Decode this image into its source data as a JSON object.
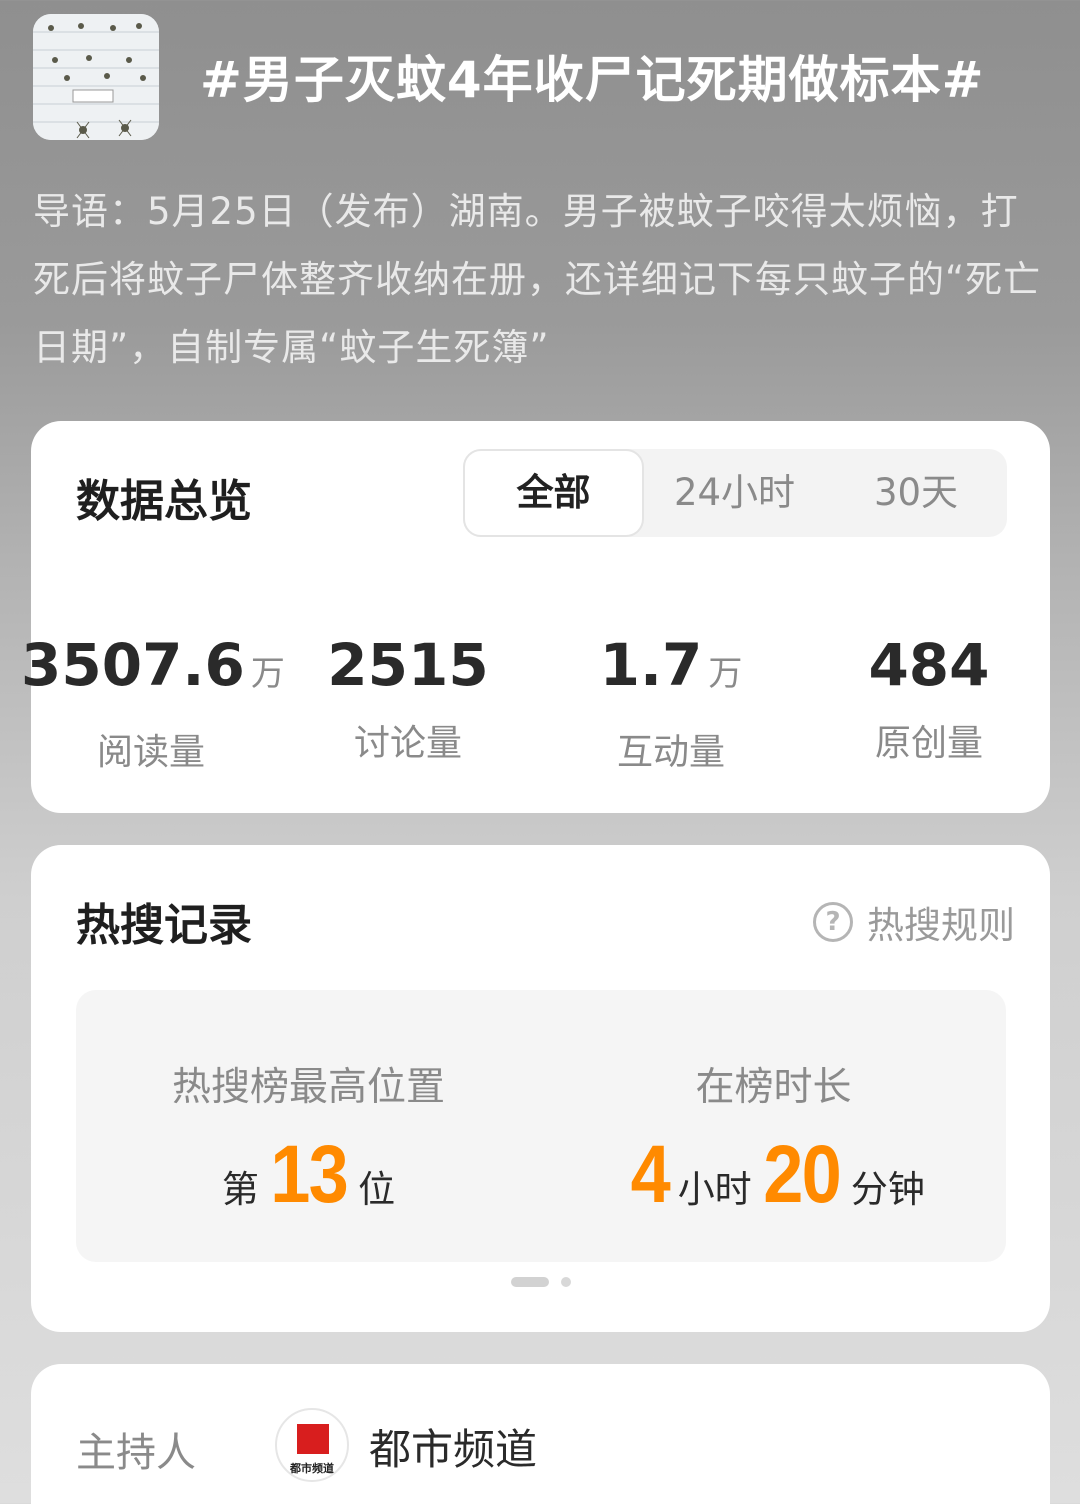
{
  "header": {
    "thumbnail_icon": "mosquito-specimen-thumbnail",
    "title": "#男子灭蚊4年收尸记死期做标本#",
    "intro": "导语：5月25日（发布）湖南。男子被蚊子咬得太烦恼，打死后将蚊子尸体整齐收纳在册，还详细记下每只蚊子的“死亡日期”，自制专属“蚊子生死簿”"
  },
  "overview": {
    "title": "数据总览",
    "tabs": [
      {
        "label": "全部",
        "active": true
      },
      {
        "label": "24小时",
        "active": false
      },
      {
        "label": "30天",
        "active": false
      }
    ],
    "stats": [
      {
        "value": "3507.6",
        "unit": "万",
        "label": "阅读量"
      },
      {
        "value": "2515",
        "unit": "",
        "label": "讨论量"
      },
      {
        "value": "1.7",
        "unit": "万",
        "label": "互动量"
      },
      {
        "value": "484",
        "unit": "",
        "label": "原创量"
      }
    ]
  },
  "hot_search": {
    "title": "热搜记录",
    "rules_label": "热搜规则",
    "rules_icon": "question-circle-icon",
    "highest": {
      "label": "热搜榜最高位置",
      "prefix": "第",
      "number": "13",
      "suffix": "位"
    },
    "duration": {
      "label": "在榜时长",
      "hours": "4",
      "hours_unit": "小时",
      "minutes": "20",
      "minutes_unit": "分钟"
    },
    "pager": {
      "pages": 2,
      "active": 1
    }
  },
  "host": {
    "label": "主持人",
    "avatar_caption": "都市频道",
    "name": "都市频道",
    "avatar_color": "#d81e1e"
  },
  "colors": {
    "accent": "#ff8a00"
  }
}
